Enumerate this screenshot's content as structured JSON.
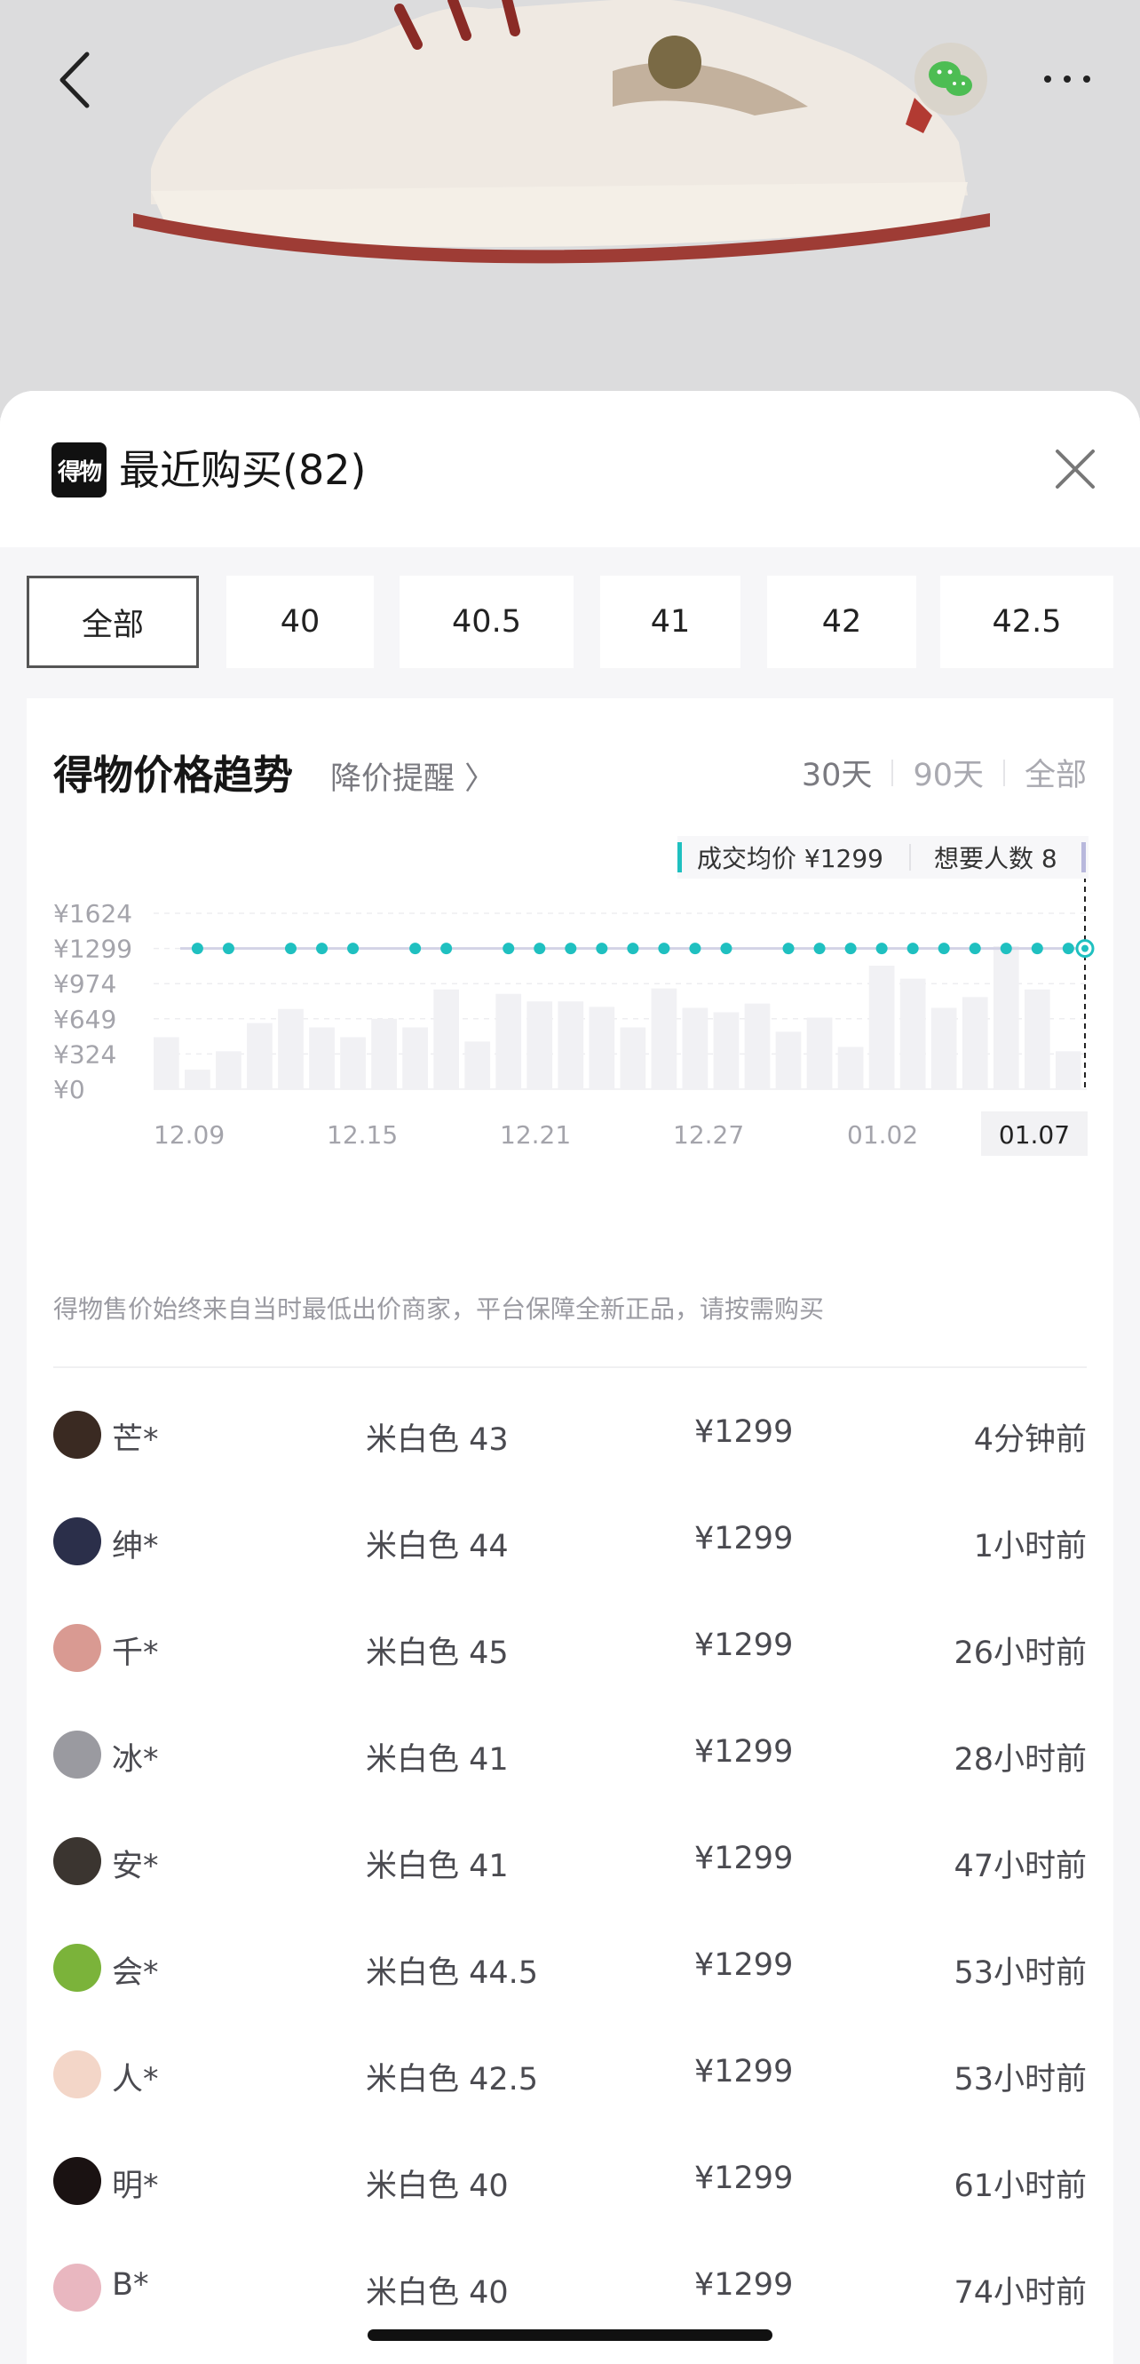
{
  "sheet": {
    "title": "最近购买(82)",
    "logo_text": "得物"
  },
  "size_tabs": [
    "全部",
    "40",
    "40.5",
    "41",
    "42",
    "42.5"
  ],
  "trend": {
    "title": "得物价格趋势",
    "alert_link": "降价提醒 〉",
    "range_tabs": [
      "30天",
      "90天",
      "全部"
    ],
    "selected_range": "30天",
    "tooltip": {
      "avg_price": "成交均价 ¥1299",
      "wanted": "想要人数 8"
    },
    "notice": "得物售价始终来自当时最低出价商家，平台保障全新正品，请按需购买"
  },
  "chart_data": {
    "type": "bar",
    "y_ticks": [
      "¥1624",
      "¥1299",
      "¥974",
      "¥649",
      "¥324",
      "¥0"
    ],
    "ylim": [
      0,
      1624
    ],
    "x_ticks": [
      "12.09",
      "12.15",
      "12.21",
      "12.27",
      "01.02",
      "01.07"
    ],
    "selected_x": "01.07",
    "bars": [
      480,
      180,
      350,
      610,
      740,
      570,
      480,
      650,
      570,
      920,
      440,
      880,
      810,
      810,
      760,
      570,
      930,
      750,
      710,
      790,
      530,
      660,
      390,
      1140,
      1020,
      750,
      850,
      1320,
      920,
      350
    ],
    "price_series": [
      {
        "index": 1,
        "value": 1299
      },
      {
        "index": 2,
        "value": 1299
      },
      {
        "index": 4,
        "value": 1299
      },
      {
        "index": 5,
        "value": 1299
      },
      {
        "index": 6,
        "value": 1299
      },
      {
        "index": 8,
        "value": 1299
      },
      {
        "index": 9,
        "value": 1299
      },
      {
        "index": 11,
        "value": 1299
      },
      {
        "index": 12,
        "value": 1299
      },
      {
        "index": 13,
        "value": 1299
      },
      {
        "index": 14,
        "value": 1299
      },
      {
        "index": 15,
        "value": 1299
      },
      {
        "index": 16,
        "value": 1299
      },
      {
        "index": 17,
        "value": 1299
      },
      {
        "index": 18,
        "value": 1299
      },
      {
        "index": 20,
        "value": 1299
      },
      {
        "index": 21,
        "value": 1299
      },
      {
        "index": 22,
        "value": 1299
      },
      {
        "index": 23,
        "value": 1299
      },
      {
        "index": 24,
        "value": 1299
      },
      {
        "index": 25,
        "value": 1299
      },
      {
        "index": 26,
        "value": 1299
      },
      {
        "index": 27,
        "value": 1299
      },
      {
        "index": 28,
        "value": 1299
      },
      {
        "index": 29,
        "value": 1299
      }
    ],
    "colors": {
      "bar": "#f1f1f4",
      "line": "#d3d3e6",
      "dot": "#1fc0c0"
    }
  },
  "purchases": [
    {
      "buyer": "芒*",
      "spec": "米白色 43",
      "price": "¥1299",
      "time": "4分钟前",
      "avatar_color": "#3a2a22"
    },
    {
      "buyer": "绅*",
      "spec": "米白色 44",
      "price": "¥1299",
      "time": "1小时前",
      "avatar_color": "#2b2f4a"
    },
    {
      "buyer": "千*",
      "spec": "米白色 45",
      "price": "¥1299",
      "time": "26小时前",
      "avatar_color": "#d99a92"
    },
    {
      "buyer": "冰*",
      "spec": "米白色 41",
      "price": "¥1299",
      "time": "28小时前",
      "avatar_color": "#9a9aa0"
    },
    {
      "buyer": "安*",
      "spec": "米白色 41",
      "price": "¥1299",
      "time": "47小时前",
      "avatar_color": "#3b3530"
    },
    {
      "buyer": "会*",
      "spec": "米白色 44.5",
      "price": "¥1299",
      "time": "53小时前",
      "avatar_color": "#7bb33a"
    },
    {
      "buyer": "人*",
      "spec": "米白色 42.5",
      "price": "¥1299",
      "time": "53小时前",
      "avatar_color": "#f3d6c8"
    },
    {
      "buyer": "明*",
      "spec": "米白色 40",
      "price": "¥1299",
      "time": "61小时前",
      "avatar_color": "#1a1212"
    },
    {
      "buyer": "B*",
      "spec": "米白色 40",
      "price": "¥1299",
      "time": "74小时前",
      "avatar_color": "#e9b7c0"
    }
  ]
}
